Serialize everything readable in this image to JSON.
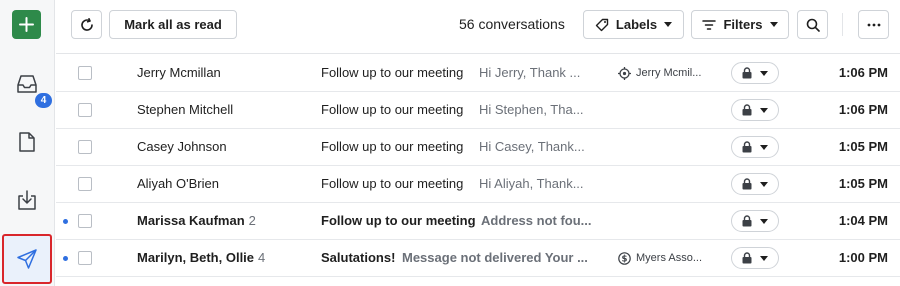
{
  "rail": {
    "compose_icon": "plus-icon",
    "inbox_badge": "4",
    "items": [
      "inbox-icon",
      "drafts-icon",
      "archive-icon",
      "sent-icon"
    ]
  },
  "toolbar": {
    "refresh_icon": "refresh-icon",
    "mark_all_read": "Mark all as read",
    "conversation_count": "56 conversations",
    "labels": "Labels",
    "filters": "Filters",
    "search_icon": "search-icon",
    "more_icon": "more-icon"
  },
  "rows": [
    {
      "from": "Jerry Mcmillan",
      "count": "",
      "subject": "Follow up to our meeting",
      "preview": "Hi Jerry, Thank ...",
      "tag": "Jerry Mcmil...",
      "tag_icon": "target-icon",
      "time": "1:06 PM",
      "unread": false
    },
    {
      "from": "Stephen Mitchell",
      "count": "",
      "subject": "Follow up to our meeting",
      "preview": "Hi Stephen, Tha...",
      "tag": "",
      "tag_icon": "",
      "time": "1:06 PM",
      "unread": false
    },
    {
      "from": "Casey Johnson",
      "count": "",
      "subject": "Follow up to our meeting",
      "preview": "Hi Casey, Thank...",
      "tag": "",
      "tag_icon": "",
      "time": "1:05 PM",
      "unread": false
    },
    {
      "from": "Aliyah O'Brien",
      "count": "",
      "subject": "Follow up to our meeting",
      "preview": "Hi Aliyah, Thank...",
      "tag": "",
      "tag_icon": "",
      "time": "1:05 PM",
      "unread": false
    },
    {
      "from": "Marissa Kaufman",
      "count": "2",
      "subject": "Follow up to our meeting",
      "preview": "Address not fou...",
      "tag": "",
      "tag_icon": "",
      "time": "1:04 PM",
      "unread": true
    },
    {
      "from": "Marilyn, Beth, Ollie",
      "count": "4",
      "subject": "Salutations!",
      "preview": "Message not delivered Your ...",
      "tag": "Myers Asso...",
      "tag_icon": "dollar-icon",
      "time": "1:00 PM",
      "unread": true
    }
  ]
}
